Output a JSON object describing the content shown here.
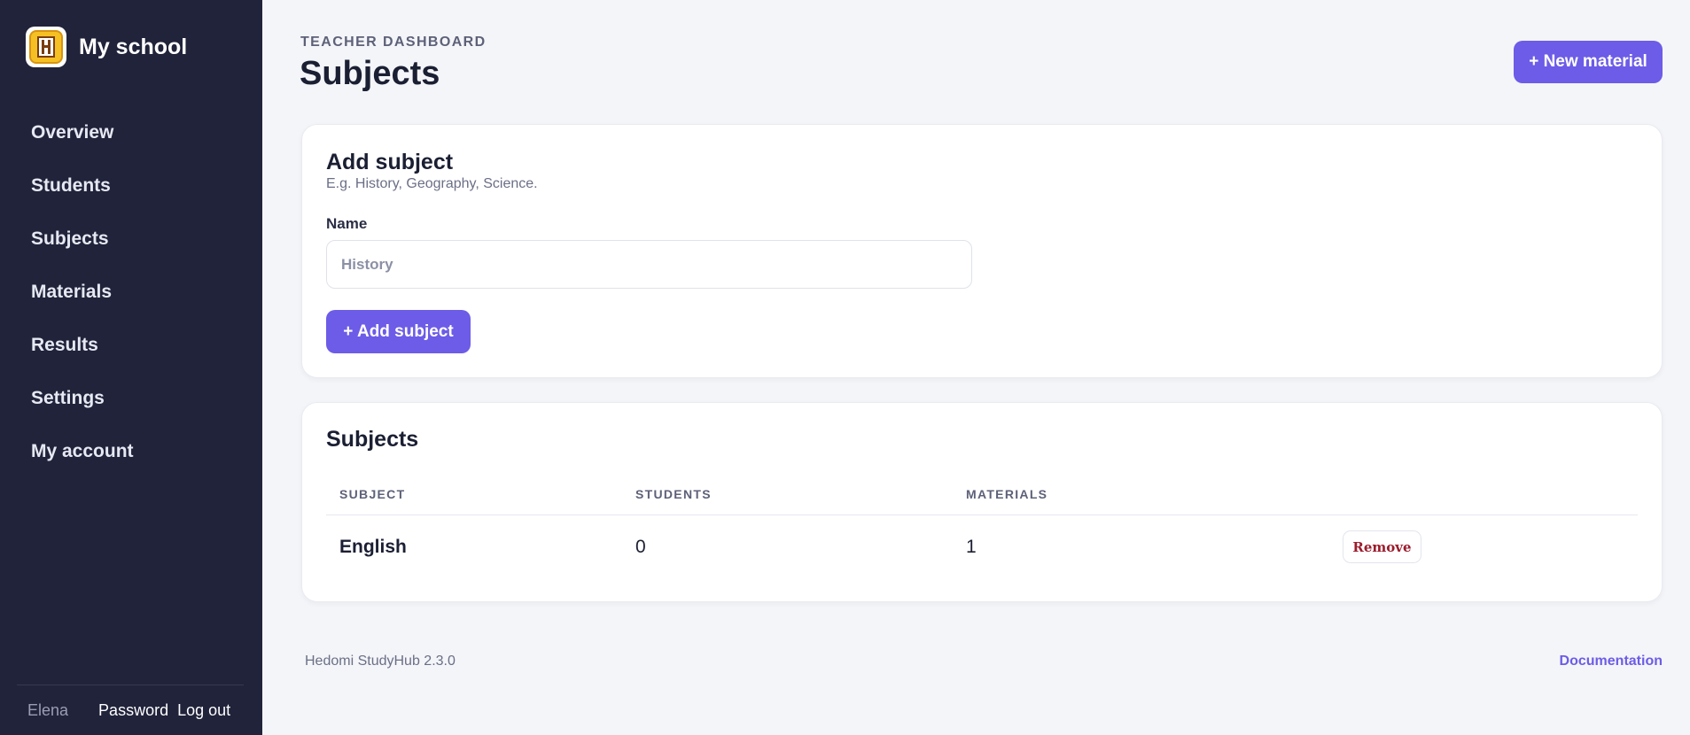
{
  "brand": {
    "name": "My school",
    "logo_icon": "school-icon"
  },
  "sidebar": {
    "items": [
      {
        "label": "Overview"
      },
      {
        "label": "Students"
      },
      {
        "label": "Subjects"
      },
      {
        "label": "Materials"
      },
      {
        "label": "Results"
      },
      {
        "label": "Settings"
      },
      {
        "label": "My account"
      }
    ],
    "footer": {
      "user": "Elena",
      "password_label": "Password",
      "logout_label": "Log out"
    }
  },
  "header": {
    "eyebrow": "TEACHER DASHBOARD",
    "title": "Subjects",
    "new_material_label": "+ New material"
  },
  "add_subject": {
    "title": "Add subject",
    "subtitle": "E.g. History, Geography, Science.",
    "name_label": "Name",
    "name_placeholder": "History",
    "name_value": "",
    "submit_label": "+ Add subject"
  },
  "subjects_table": {
    "title": "Subjects",
    "columns": [
      "SUBJECT",
      "STUDENTS",
      "MATERIALS"
    ],
    "rows": [
      {
        "subject": "English",
        "students": "0",
        "materials": "1",
        "action_label": "Remove"
      }
    ]
  },
  "footer": {
    "version": "Hedomi StudyHub 2.3.0",
    "docs_label": "Documentation"
  },
  "colors": {
    "accent": "#6c5ce7",
    "sidebar_bg": "#20233a",
    "danger": "#9b1c2c",
    "page_bg": "#f4f5f9"
  }
}
